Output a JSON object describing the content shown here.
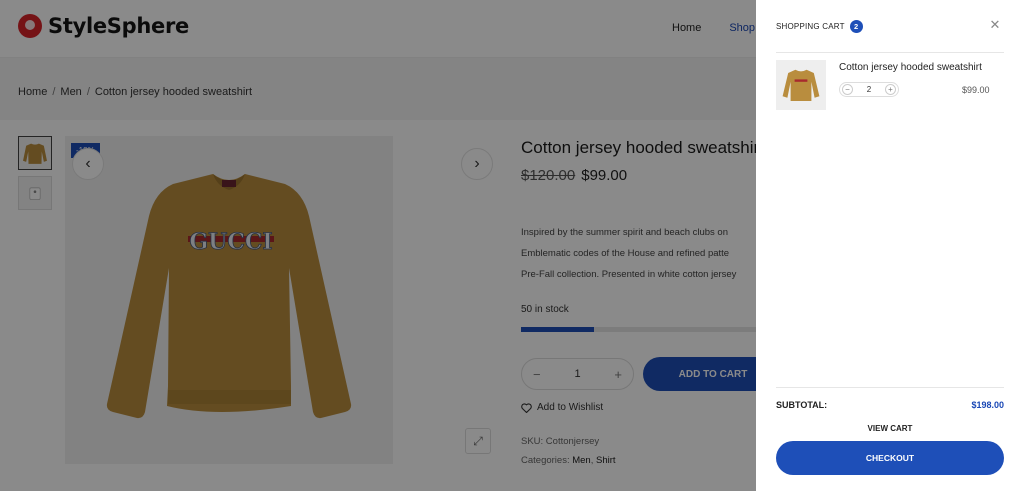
{
  "site": {
    "name": "StyleSphere"
  },
  "nav": {
    "items": [
      "Home",
      "Shop"
    ]
  },
  "breadcrumb": [
    "Home",
    "Men",
    "Cotton jersey hooded sweatshirt"
  ],
  "product": {
    "badge": "-18%",
    "name": "Cotton jersey hooded sweatshirt",
    "old_price": "$120.00",
    "price": "$99.00",
    "description": [
      "Inspired by the summer spirit and beach clubs on",
      "Emblematic codes of the House and refined patte",
      "Pre-Fall collection. Presented in white cotton jersey"
    ],
    "stock_text": "50 in stock",
    "stock_level": 0.31,
    "quantity": "1",
    "add_to_cart_label": "ADD TO CART",
    "wishlist_label": "Add to Wishlist",
    "sku": "SKU: Cottonjersey",
    "categories_label": "Categories:",
    "categories": [
      "Men",
      "Shirt"
    ],
    "color": "#b98d3e"
  },
  "cart": {
    "title": "SHOPPING CART",
    "count": "2",
    "item": {
      "name": "Cotton jersey hooded sweatshirt",
      "quantity": "2",
      "price": "$99.00"
    },
    "subtotal_label": "SUBTOTAL:",
    "subtotal_value": "$198.00",
    "view_cart_label": "VIEW CART",
    "checkout_label": "CHECKOUT"
  },
  "colors": {
    "accent": "#1e4fb8",
    "logo": "#d8232a"
  },
  "icons": [
    "logo-mark-icon",
    "close-icon",
    "chevron-left-icon",
    "chevron-right-icon",
    "heart-icon",
    "expand-icon",
    "minus-icon",
    "plus-icon"
  ]
}
